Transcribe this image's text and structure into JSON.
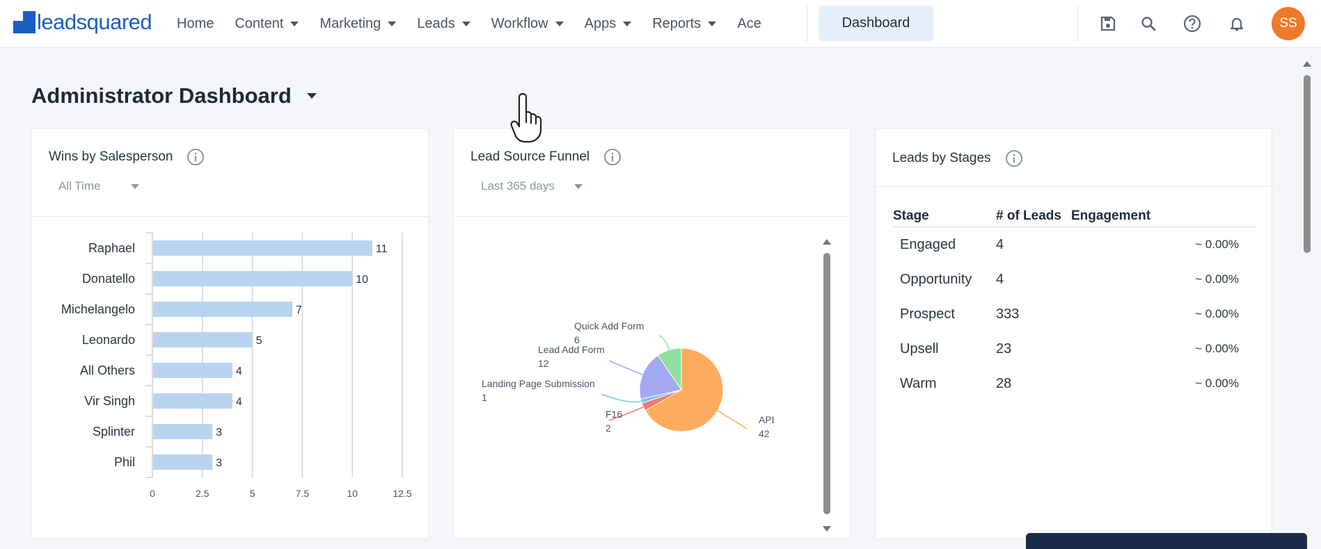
{
  "brand": {
    "name": "leadsquared"
  },
  "nav": {
    "items": [
      {
        "label": "Home",
        "dropdown": false
      },
      {
        "label": "Content",
        "dropdown": true
      },
      {
        "label": "Marketing",
        "dropdown": true
      },
      {
        "label": "Leads",
        "dropdown": true
      },
      {
        "label": "Workflow",
        "dropdown": true
      },
      {
        "label": "Apps",
        "dropdown": true
      },
      {
        "label": "Reports",
        "dropdown": true
      },
      {
        "label": "Ace",
        "dropdown": false
      }
    ],
    "active_button": "Dashboard",
    "icons": [
      "save-icon",
      "search-icon",
      "help-icon",
      "bell-icon"
    ],
    "avatar_initials": "SS",
    "avatar_color": "#ee7a2c"
  },
  "page": {
    "title": "Administrator Dashboard"
  },
  "cards": {
    "wins": {
      "title": "Wins by Salesperson",
      "filter": "All Time",
      "chart_data": {
        "type": "bar",
        "orientation": "horizontal",
        "categories": [
          "Raphael",
          "Donatello",
          "Michelangelo",
          "Leonardo",
          "All Others",
          "Vir Singh",
          "Splinter",
          "Phil"
        ],
        "values": [
          11,
          10,
          7,
          5,
          4,
          4,
          3,
          3
        ],
        "xticks": [
          "0",
          "2.5",
          "5",
          "7.5",
          "10",
          "12.5"
        ],
        "xlim": [
          0,
          12.5
        ],
        "bar_color": "#b8d3f0",
        "grid": true
      }
    },
    "funnel": {
      "title": "Lead Source Funnel",
      "filter": "Last 365 days",
      "chart_data": {
        "type": "pie",
        "slices": [
          {
            "label": "API",
            "value": 42,
            "color": "#ffab5e"
          },
          {
            "label": "F16",
            "value": 2,
            "color": "#f47a72"
          },
          {
            "label": "Landing Page Submission",
            "value": 1,
            "color": "#6ec3f0"
          },
          {
            "label": "Lead Add Form",
            "value": 12,
            "color": "#a3a8f2"
          },
          {
            "label": "Quick Add Form",
            "value": 6,
            "color": "#8fe3a0"
          }
        ]
      }
    },
    "stages": {
      "title": "Leads by Stages",
      "columns": [
        "Stage",
        "# of Leads",
        "Engagement"
      ],
      "rows": [
        {
          "stage": "Engaged",
          "leads": "4",
          "engagement": "~ 0.00%"
        },
        {
          "stage": "Opportunity",
          "leads": "4",
          "engagement": "~ 0.00%"
        },
        {
          "stage": "Prospect",
          "leads": "333",
          "engagement": "~ 0.00%"
        },
        {
          "stage": "Upsell",
          "leads": "23",
          "engagement": "~ 0.00%"
        },
        {
          "stage": "Warm",
          "leads": "28",
          "engagement": "~ 0.00%"
        }
      ]
    }
  }
}
